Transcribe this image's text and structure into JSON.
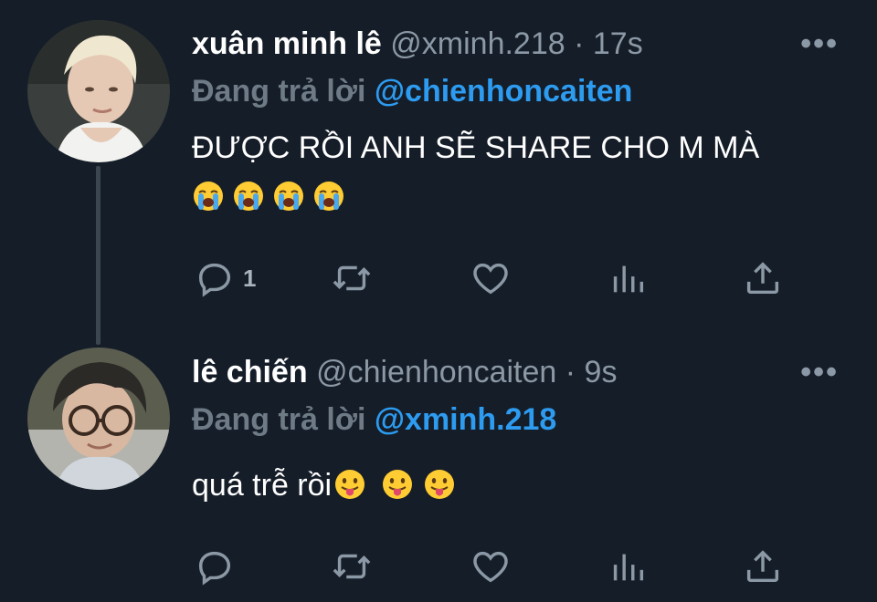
{
  "tweets": [
    {
      "display_name": "xuân minh lê",
      "handle": "@xminh.218",
      "sep": " · ",
      "time": "17s",
      "more": "•••",
      "reply_label": "Đang trả lời",
      "reply_to": "@chienhoncaiten",
      "text_line1": "ĐƯỢC RỒI ANH SẼ SHARE CHO M MÀ",
      "emojis": [
        "loudly-crying-face",
        "loudly-crying-face",
        "loudly-crying-face",
        "loudly-crying-face"
      ],
      "actions": {
        "reply_count": "1",
        "retweet_count": "",
        "like_count": ""
      }
    },
    {
      "display_name": "lê chiến",
      "handle": "@chienhoncaiten",
      "sep": " · ",
      "time": "9s",
      "more": "•••",
      "reply_label": "Đang trả lời",
      "reply_to": "@xminh.218",
      "text_line1": "quá trễ rồi",
      "emojis": [
        "face-with-tongue",
        "face-with-tongue",
        "face-with-tongue"
      ],
      "actions": {
        "reply_count": "",
        "retweet_count": "",
        "like_count": ""
      }
    }
  ],
  "colors": {
    "background": "#151d28",
    "link": "#2d9bf0",
    "muted": "#8b98a5"
  }
}
